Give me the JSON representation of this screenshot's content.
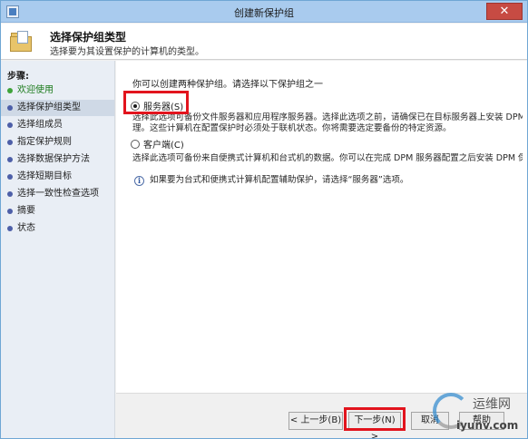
{
  "window": {
    "title": "创建新保护组",
    "close_glyph": "✕"
  },
  "header": {
    "title": "选择保护组类型",
    "subtitle": "选择要为其设置保护的计算机的类型。"
  },
  "steps": {
    "heading": "步骤:",
    "items": [
      {
        "label": "欢迎使用",
        "state": "done"
      },
      {
        "label": "选择保护组类型",
        "state": "current"
      },
      {
        "label": "选择组成员",
        "state": "pending"
      },
      {
        "label": "指定保护规则",
        "state": "pending"
      },
      {
        "label": "选择数据保护方法",
        "state": "pending"
      },
      {
        "label": "选择短期目标",
        "state": "pending"
      },
      {
        "label": "选择一致性检查选项",
        "state": "pending"
      },
      {
        "label": "摘要",
        "state": "pending"
      },
      {
        "label": "状态",
        "state": "pending"
      }
    ]
  },
  "content": {
    "intro": "你可以创建两种保护组。请选择以下保护组之一",
    "server_option": {
      "label": "服务器(S)",
      "selected": true,
      "description_line1": "选择此选项可备份文件服务器和应用程序服务器。选择此选项之前，请确保已在目标服务器上安装 DPM 保护代理",
      "description_line2": "理。这些计算机在配置保护时必须处于联机状态。你将需要选定要备份的特定资源。"
    },
    "client_option": {
      "label": "客户端(C)",
      "selected": false,
      "description": "选择此选项可备份来自便携式计算机和台式机的数据。你可以在完成 DPM 服务器配置之后安装 DPM 保护代理。"
    },
    "info": "如果要为台式和便携式计算机配置辅助保护，请选择“服务器”选项。"
  },
  "footer": {
    "prev": "< 上一步(B)",
    "next": "下一步(N) >",
    "cancel": "取消",
    "help": "帮助"
  },
  "watermark": {
    "brand": "运维网",
    "url": "iyunv.com"
  },
  "colors": {
    "highlight": "#e2141d",
    "titlebar": "#a9cbee",
    "steps_bg": "#e9eef5",
    "close": "#c74b43"
  }
}
